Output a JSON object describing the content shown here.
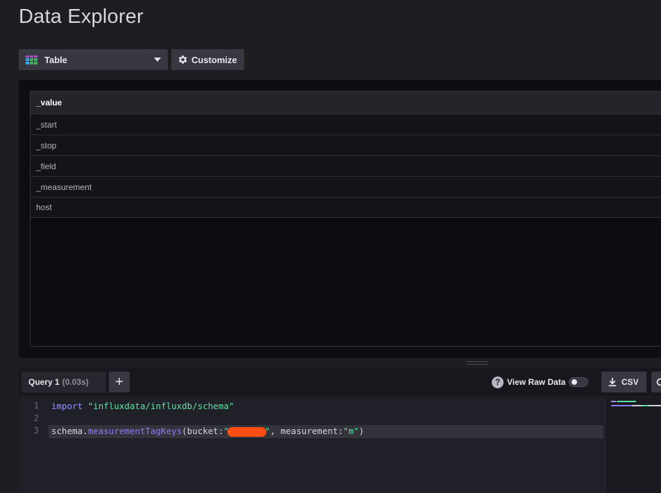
{
  "page": {
    "title": "Data Explorer"
  },
  "toolbar": {
    "visualization_type": "Table",
    "customize_label": "Customize"
  },
  "table": {
    "header": "_value",
    "rows": [
      "_start",
      "_stop",
      "_field",
      "_measurement",
      "host"
    ]
  },
  "query_bar": {
    "tab_name": "Query 1",
    "tab_time": "(0.03s)",
    "add_label": "+",
    "raw_data_label": "View Raw Data",
    "raw_data_enabled": false,
    "csv_label": "CSV"
  },
  "editor": {
    "line_numbers": [
      "1",
      "2",
      "3"
    ],
    "line1": {
      "keyword": "import",
      "string": "\"influxdata/influxdb/schema\""
    },
    "line3": {
      "object": "schema.",
      "function": "measurementTagKeys",
      "args_start": "(bucket:",
      "string_open": "\"",
      "string_close": "\"",
      "args_mid": ", measurement:",
      "measurement_value": "\"m\"",
      "args_end": ")"
    }
  },
  "colors": {
    "background": "#1d1d22",
    "panel": "#0e0e12",
    "button": "#383842",
    "redaction": "#ff4d14",
    "string": "#5ee4a2",
    "keyword": "#9394ff"
  },
  "icons": {
    "vis_type": "table-icon",
    "customize": "gear-icon",
    "help": "question-icon",
    "csv": "download-icon",
    "refresh": "refresh-icon",
    "dropdown": "caret-down-icon"
  }
}
